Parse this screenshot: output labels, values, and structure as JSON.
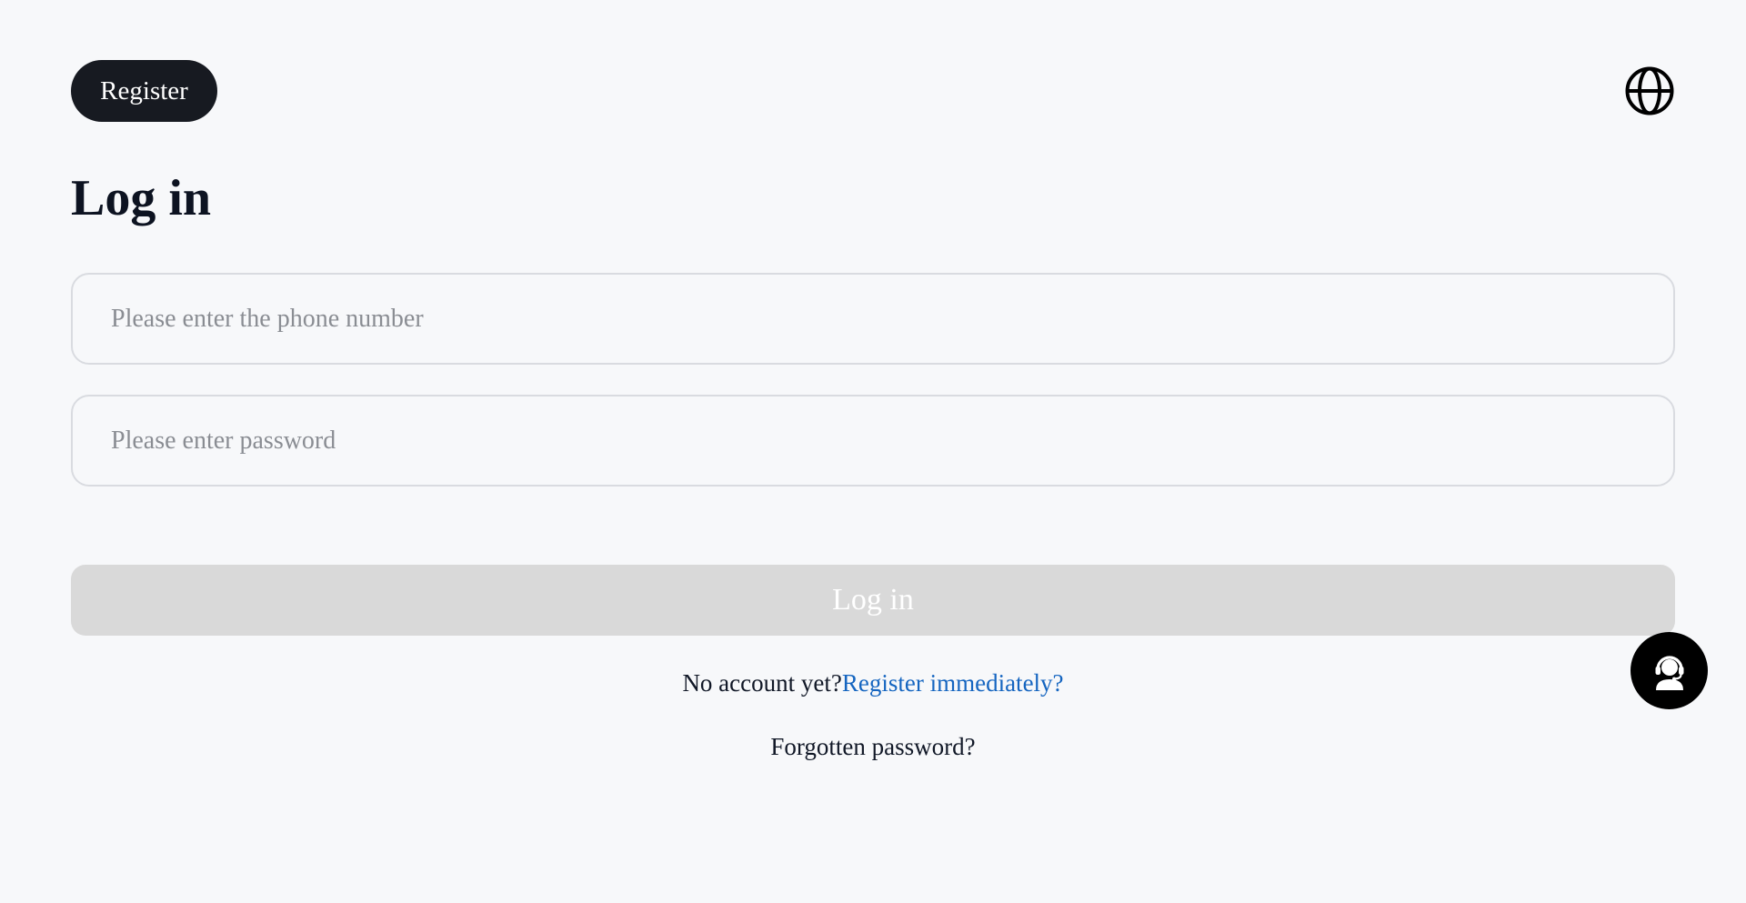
{
  "header": {
    "register_label": "Register",
    "language_icon": "globe-icon"
  },
  "main": {
    "title": "Log in",
    "phone_field": {
      "placeholder": "Please enter the phone number",
      "value": ""
    },
    "password_field": {
      "placeholder": "Please enter password",
      "value": ""
    },
    "login_button_label": "Log in",
    "no_account_text": "No account yet?",
    "register_link_text": "Register immediately?",
    "forgot_password_text": "Forgotten password?"
  },
  "support": {
    "icon": "customer-service-icon"
  },
  "colors": {
    "background": "#f7f8fa",
    "register_pill": "#171a21",
    "login_button_disabled": "#d9d9d9",
    "link": "#1565c0",
    "support_button": "#000000"
  }
}
